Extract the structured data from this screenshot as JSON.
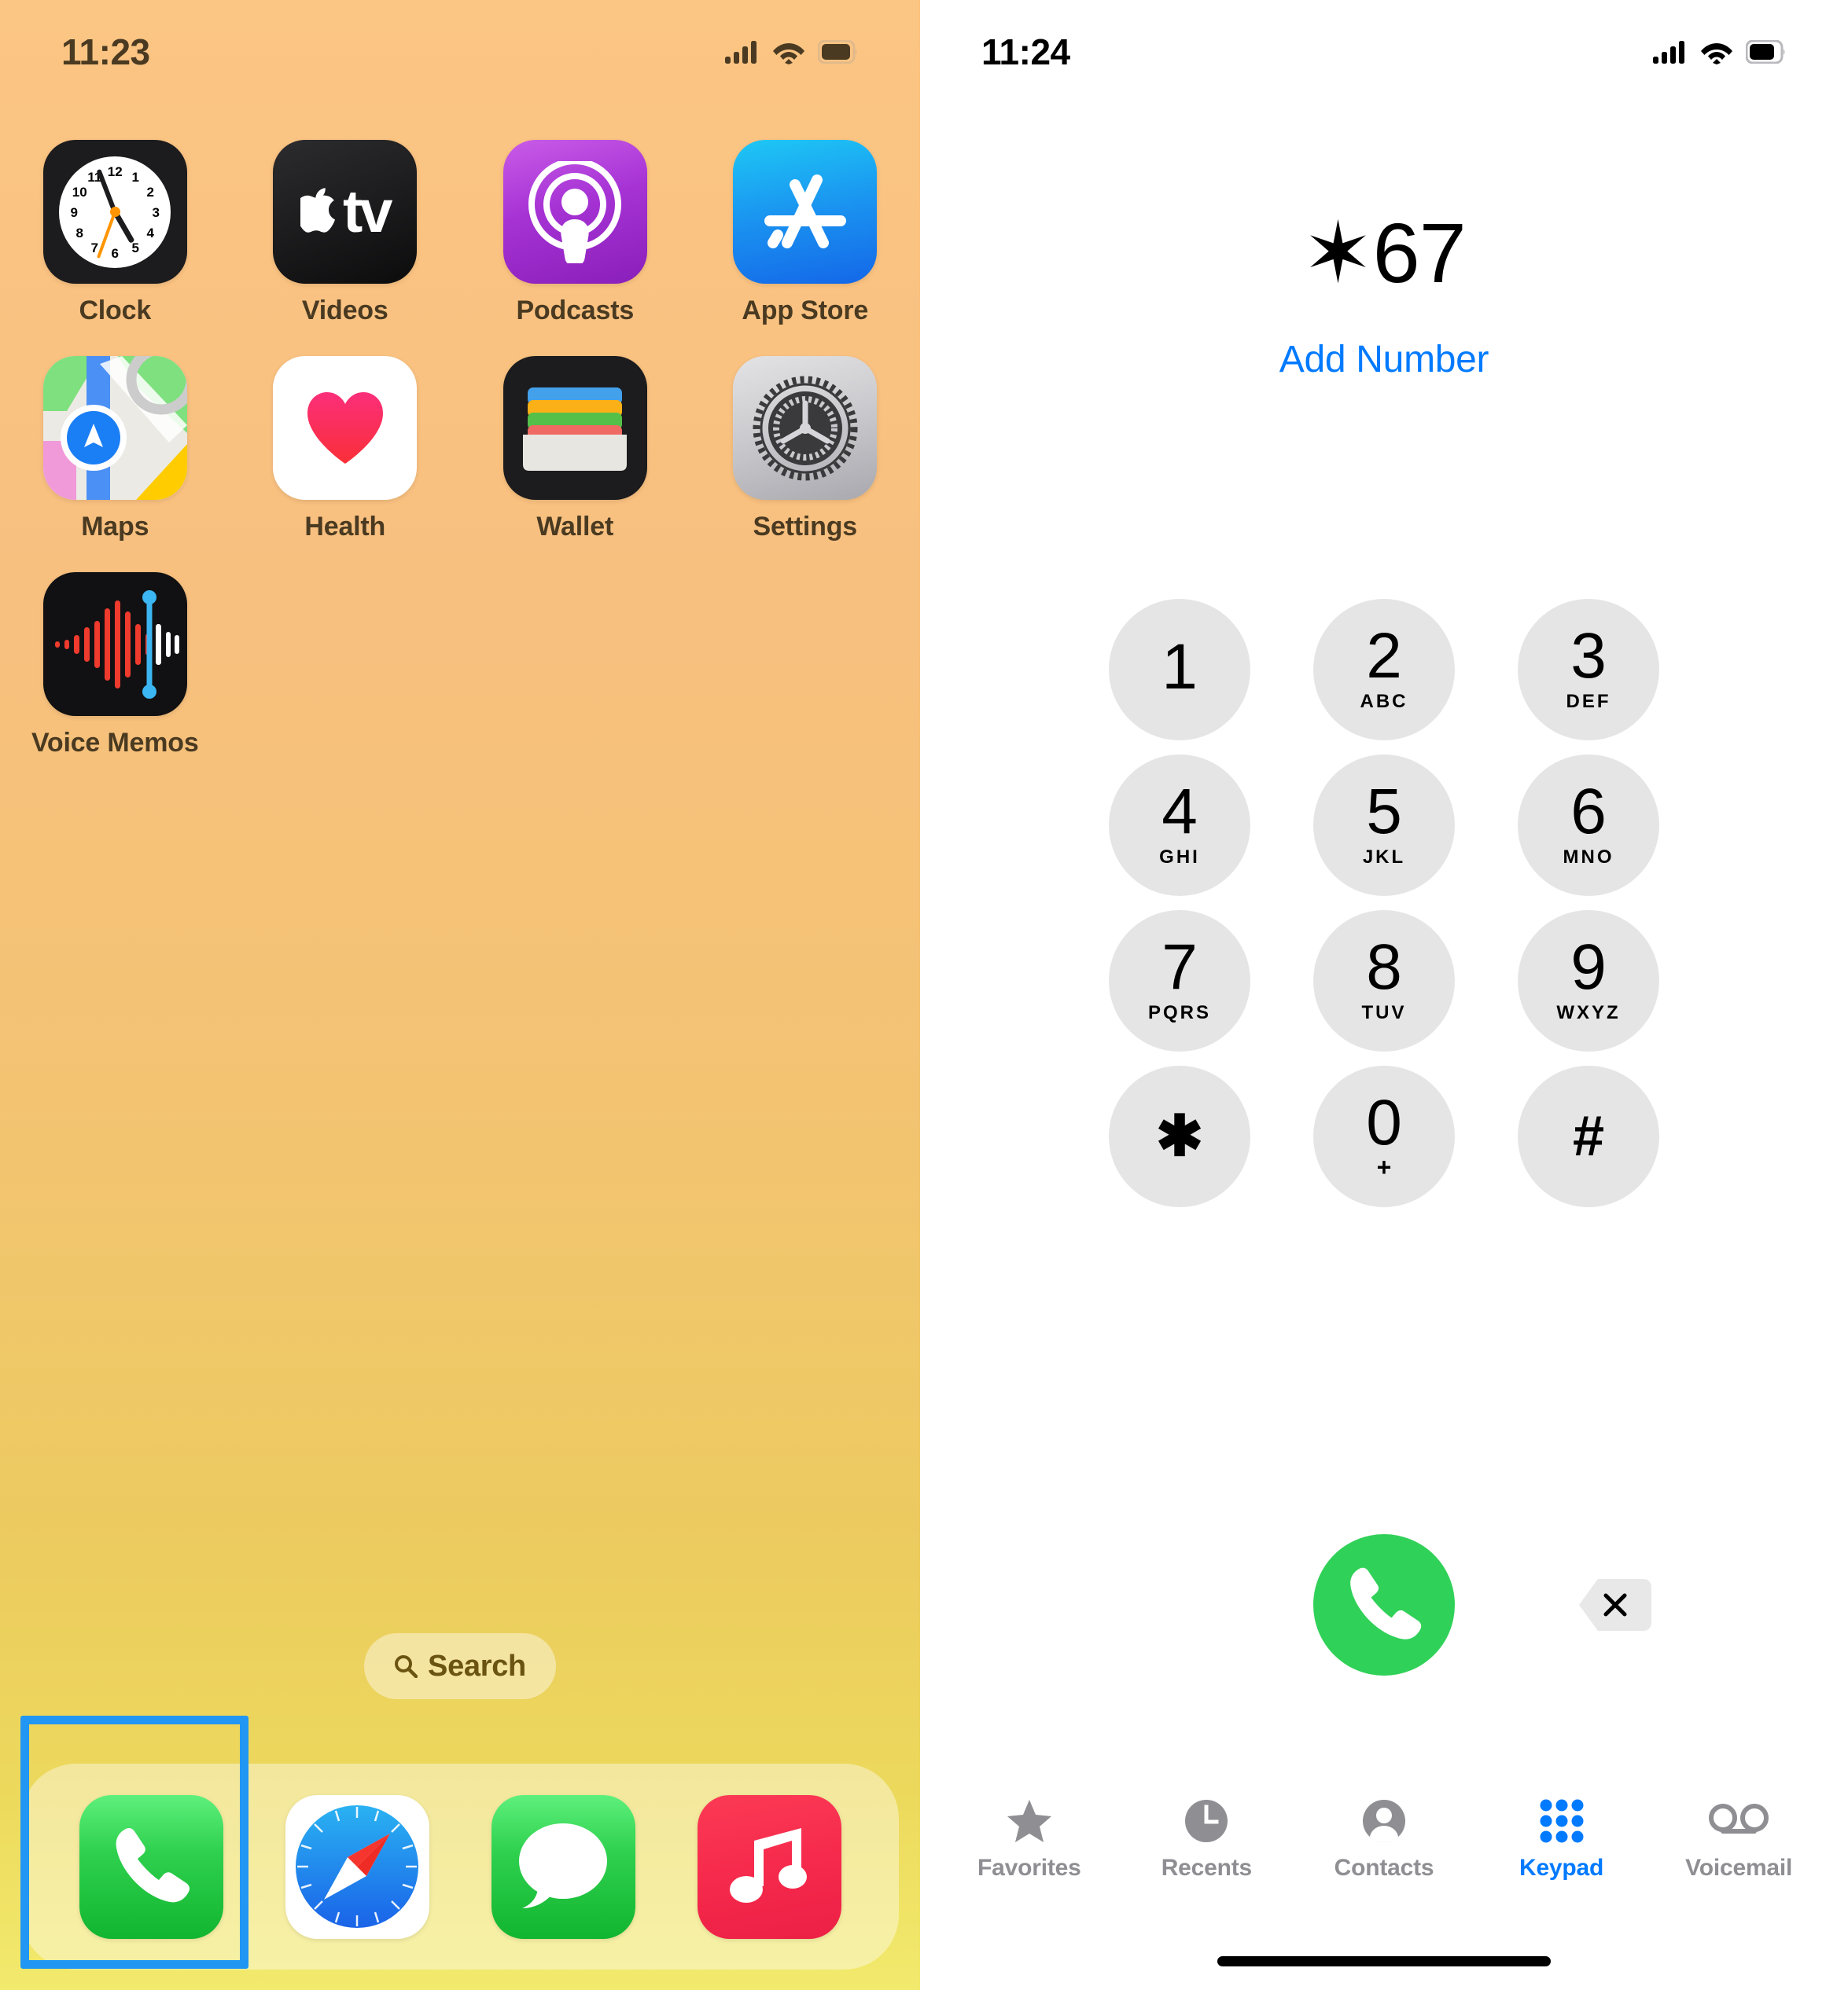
{
  "home": {
    "status": {
      "time": "11:23",
      "cellular": "signal-bars",
      "wifi": "wifi-icon",
      "battery": "battery-icon"
    },
    "apps": [
      {
        "label": "Clock",
        "icon": "clock-icon"
      },
      {
        "label": "Videos",
        "icon": "apple-tv-icon"
      },
      {
        "label": "Podcasts",
        "icon": "podcasts-icon"
      },
      {
        "label": "App Store",
        "icon": "app-store-icon"
      },
      {
        "label": "Maps",
        "icon": "maps-icon"
      },
      {
        "label": "Health",
        "icon": "health-heart-icon"
      },
      {
        "label": "Wallet",
        "icon": "wallet-icon"
      },
      {
        "label": "Settings",
        "icon": "settings-gear-icon"
      },
      {
        "label": "Voice Memos",
        "icon": "voice-memos-waveform-icon"
      }
    ],
    "clock_numerals": [
      "12",
      "1",
      "2",
      "3",
      "4",
      "5",
      "6",
      "7",
      "8",
      "9",
      "10",
      "11"
    ],
    "tv_label": "tv",
    "search": {
      "label": "Search",
      "icon": "search-magnifier-icon"
    },
    "dock": [
      {
        "label": "Phone",
        "icon": "phone-handset-icon"
      },
      {
        "label": "Safari",
        "icon": "safari-compass-icon"
      },
      {
        "label": "Messages",
        "icon": "messages-bubble-icon"
      },
      {
        "label": "Music",
        "icon": "music-note-icon"
      }
    ],
    "highlight": {
      "target": "Phone",
      "color": "#2196f3"
    }
  },
  "phone": {
    "status": {
      "time": "11:24",
      "cellular": "signal-bars",
      "wifi": "wifi-icon",
      "battery": "battery-icon"
    },
    "dialed_number": "✶67",
    "add_number_label": "Add Number",
    "keys": [
      {
        "digit": "1",
        "letters": ""
      },
      {
        "digit": "2",
        "letters": "ABC"
      },
      {
        "digit": "3",
        "letters": "DEF"
      },
      {
        "digit": "4",
        "letters": "GHI"
      },
      {
        "digit": "5",
        "letters": "JKL"
      },
      {
        "digit": "6",
        "letters": "MNO"
      },
      {
        "digit": "7",
        "letters": "PQRS"
      },
      {
        "digit": "8",
        "letters": "TUV"
      },
      {
        "digit": "9",
        "letters": "WXYZ"
      },
      {
        "digit": "✱",
        "letters": ""
      },
      {
        "digit": "0",
        "letters": "+"
      },
      {
        "digit": "#",
        "letters": ""
      }
    ],
    "call_button": {
      "icon": "phone-handset-icon",
      "color": "#30d158"
    },
    "delete_button": {
      "icon": "delete-backspace-x-icon"
    },
    "tabs": [
      {
        "label": "Favorites",
        "icon": "star-icon",
        "active": false
      },
      {
        "label": "Recents",
        "icon": "clock-icon",
        "active": false
      },
      {
        "label": "Contacts",
        "icon": "person-icon",
        "active": false
      },
      {
        "label": "Keypad",
        "icon": "keypad-dots-icon",
        "active": true
      },
      {
        "label": "Voicemail",
        "icon": "voicemail-icon",
        "active": false
      }
    ],
    "accent_color": "#007aff",
    "inactive_color": "#8e8e93"
  }
}
